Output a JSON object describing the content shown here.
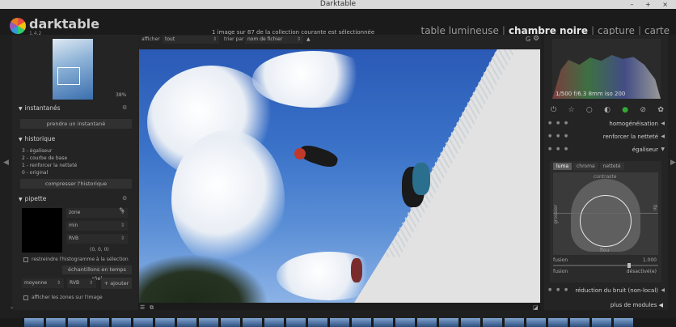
{
  "window": {
    "title": "Darktable",
    "controls": "– + ×"
  },
  "app": {
    "name": "darktable",
    "version": "1.4.2"
  },
  "collection_info": "1 image sur 87 de la collection courante est sélectionnée",
  "views": {
    "lighttable": "table lumineuse",
    "darkroom": "chambre noire",
    "capture": "capture",
    "map": "carte",
    "separator": "|"
  },
  "left": {
    "zoom": "38%",
    "snapshots": {
      "title": "instantanés",
      "button": "prendre un instantané"
    },
    "history": {
      "title": "historique",
      "items": [
        "3 - égaliseur",
        "2 - courbe de base",
        "1 - renforcer la netteté",
        "0 - original"
      ],
      "compress": "compresser l'historique"
    },
    "picker": {
      "title": "pipette",
      "zone": "zone",
      "mode": "min",
      "color": "RVB",
      "value": "(0, 0, 0)",
      "restrict": "restreindre l'histogramme à la sélection",
      "live": "échantillons en temps réel",
      "avg": "moyenne",
      "avg_color": "RVB",
      "add": "ajouter",
      "show_zones": "afficher les zones sur l'image"
    }
  },
  "center": {
    "show_label": "afficher",
    "show_value": "tout",
    "sort_label": "trier par",
    "sort_value": "nom de fichier",
    "g_icon": "G"
  },
  "right": {
    "histogram_info": "1/500 f/6.3 8mm iso 200",
    "modules": {
      "homogeneisation": "homogénéisation",
      "nettete": "renforcer la netteté",
      "egaliseur": "égaliseur",
      "bruit": "réduction du bruit (non-local)"
    },
    "equalizer": {
      "tabs": [
        "luma",
        "chroma",
        "netteté"
      ],
      "contrast": "contraste",
      "flou": "flou",
      "grossier": "grossier",
      "fin": "fin",
      "fusion_label": "fusion",
      "fusion_value": "1.000",
      "fusion2_label": "fusion",
      "fusion2_value": "désactivé(e)"
    },
    "more_modules": "plus de modules"
  },
  "colors": {
    "accent_green": "#33aa33",
    "panel_bg": "#242424"
  }
}
